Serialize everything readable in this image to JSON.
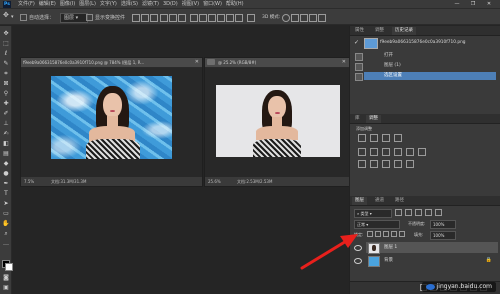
{
  "app": {
    "logo_text": "Ps",
    "menu": [
      "文件(F)",
      "编辑(E)",
      "图像(I)",
      "图层(L)",
      "文字(Y)",
      "选择(S)",
      "滤镜(T)",
      "3D(D)",
      "视图(V)",
      "窗口(W)",
      "帮助(H)"
    ],
    "window_controls": [
      "—",
      "❐",
      "✕"
    ]
  },
  "options_bar": {
    "auto_select_label": "自动选择：",
    "auto_select_value": "图层",
    "show_transform_label": "显示变换控件"
  },
  "documents": [
    {
      "tab_title": "f9eeb9a066315876e0c0a3910f710.png @ 784% (图层 1, R...",
      "zoom": "7.5%",
      "status": "文档:31.3M/31.3M",
      "background": "pool"
    },
    {
      "tab_title": "@ 25.2% (RGB/8#)",
      "zoom": "25.6%",
      "status": "文档:2.53M/2.53M",
      "background": "plain"
    }
  ],
  "history_panel": {
    "tabs": [
      "属性",
      "调整",
      "历史记录"
    ],
    "active_tab": "历史记录",
    "snapshot_name": "f9eeb9a066315876e0c0a3910f710.png",
    "items": [
      "打开",
      "图层 (1)",
      "选区设置"
    ],
    "selected_index": 2
  },
  "adjustments_panel": {
    "tabs": [
      "库",
      "调整"
    ],
    "active_tab": "调整",
    "add_label": "添加调整"
  },
  "layers_panel": {
    "tabs": [
      "图层",
      "通道",
      "路径"
    ],
    "active_tab": "图层",
    "kind_value": "类型",
    "blend_mode": "正常",
    "opacity_label": "不透明度:",
    "opacity_value": "100%",
    "lock_label": "锁定:",
    "fill_label": "填充:",
    "fill_value": "100%",
    "layers": [
      {
        "name": "图层 1",
        "selected": true
      },
      {
        "name": "背景",
        "selected": false
      }
    ]
  },
  "watermark": "jingyan.baidu.com",
  "colors": {
    "accent": "#4d7fb7",
    "arrow": "#e8201c"
  }
}
